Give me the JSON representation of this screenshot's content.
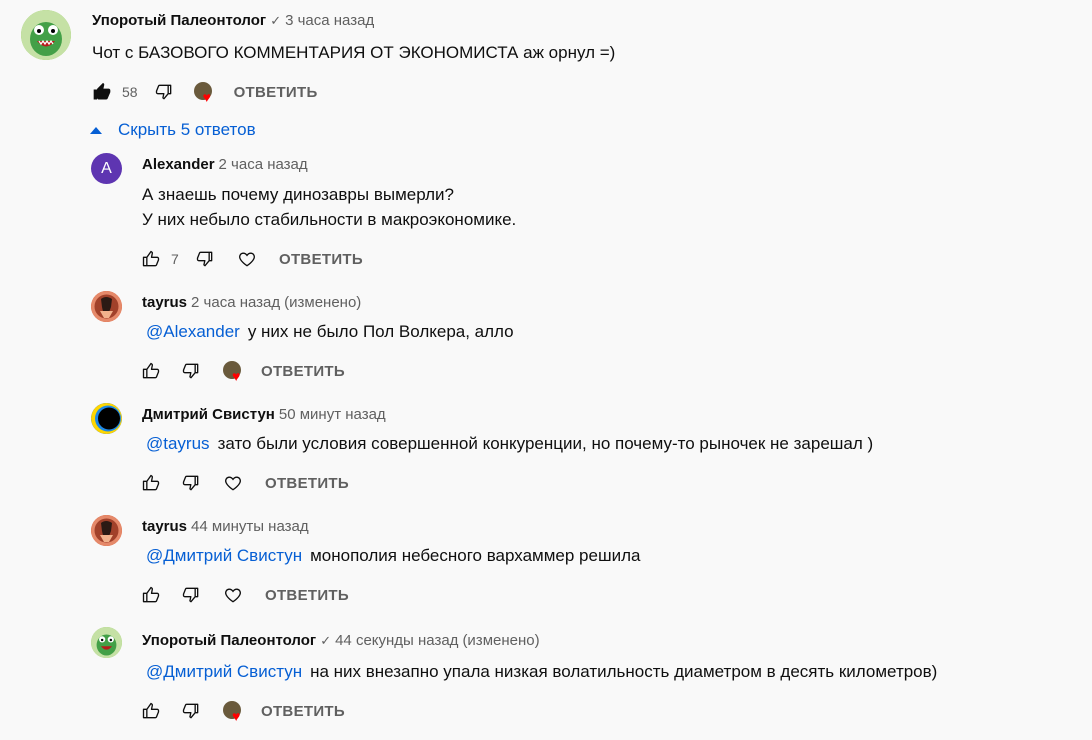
{
  "main_comment": {
    "author": "Упоротый Палеонтолог",
    "verified": "✓",
    "time": "3 часа назад",
    "text": "Чот с БАЗОВОГО КОММЕНТАРИЯ ОТ ЭКОНОМИСТА аж орнул =)",
    "likes": "58",
    "reply_label": "ОТВЕТИТЬ"
  },
  "hide_replies_label": "Скрыть 5 ответов",
  "replies": [
    {
      "author": "Alexander",
      "avatar_letter": "A",
      "time": "2 часа назад",
      "text_line1": "А знаешь почему динозавры вымерли?",
      "text_line2": "У них небыло стабильности в макроэкономике.",
      "likes": "7",
      "reply_label": "ОТВЕТИТЬ"
    },
    {
      "author": "tayrus",
      "time": "2 часа назад",
      "edited": "(изменено)",
      "mention": "@Alexander",
      "text": "у них не было Пол Волкера, алло",
      "reply_label": "ОТВЕТИТЬ"
    },
    {
      "author": "Дмитрий Свистун",
      "time": "50 минут назад",
      "mention": "@tayrus",
      "text": "зато были условия совершенной конкуренции, но почему-то рыночек не зарешал )",
      "reply_label": "ОТВЕТИТЬ"
    },
    {
      "author": "tayrus",
      "time": "44 минуты назад",
      "mention": "@Дмитрий Свистун",
      "text": "монополия небесного вархаммер решила",
      "reply_label": "ОТВЕТИТЬ"
    },
    {
      "author": "Упоротый Палеонтолог",
      "verified": "✓",
      "time": "44 секунды назад",
      "edited": "(изменено)",
      "mention": "@Дмитрий Свистун",
      "text": "на них внезапно упала низкая волатильность диаметром в десять километров)",
      "reply_label": "ОТВЕТИТЬ"
    }
  ],
  "colors": {
    "link": "#065fd4",
    "secondary": "#606060",
    "heart": "#ff0000",
    "alexander_avatar": "#5e35b1"
  }
}
